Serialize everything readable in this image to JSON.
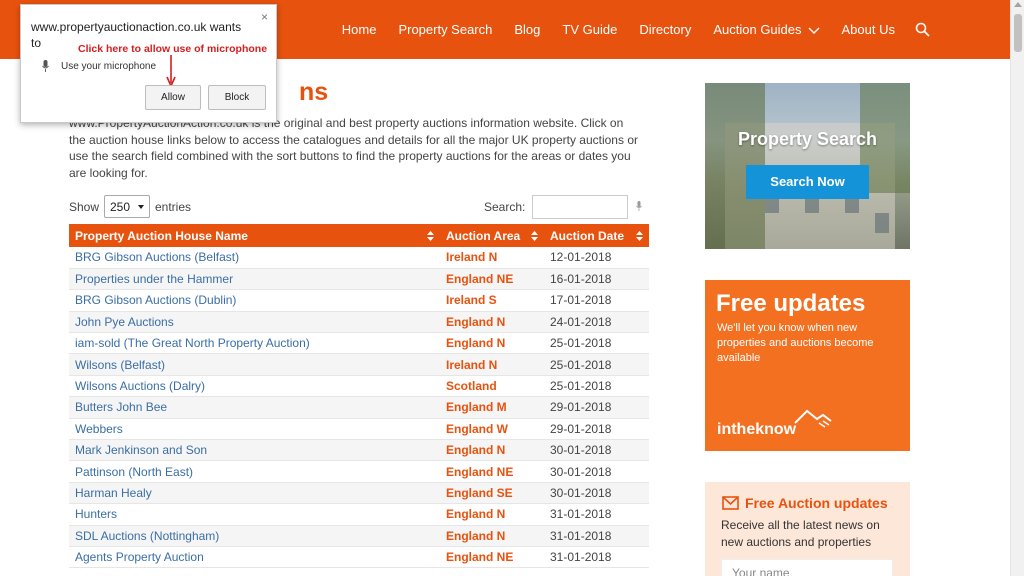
{
  "nav": {
    "items": [
      "Home",
      "Property Search",
      "Blog",
      "TV Guide",
      "Directory",
      "Auction Guides",
      "About Us"
    ],
    "icons": {
      "dropdown": "chevron-down-icon",
      "search": "search-icon"
    }
  },
  "page": {
    "title_visible": "ns",
    "intro": "www.PropertyAuctionAction.co.uk is the original and best property auctions information website. Click on the auction house links below to access the catalogues and details for all the major UK property auctions or use the search field combined with the sort buttons to find the property auctions for the areas or dates you are looking for."
  },
  "controls": {
    "show_label": "Show",
    "show_value": "250",
    "entries_label": "entries",
    "search_label": "Search:",
    "search_value": ""
  },
  "table": {
    "columns": [
      "Property Auction House Name",
      "Auction Area",
      "Auction Date"
    ],
    "rows": [
      [
        "BRG Gibson Auctions (Belfast)",
        "Ireland N",
        "12-01-2018"
      ],
      [
        "Properties under the Hammer",
        "England NE",
        "16-01-2018"
      ],
      [
        "BRG Gibson Auctions (Dublin)",
        "Ireland S",
        "17-01-2018"
      ],
      [
        "John Pye Auctions",
        "England N",
        "24-01-2018"
      ],
      [
        "iam-sold (The Great North Property Auction)",
        "England N",
        "25-01-2018"
      ],
      [
        "Wilsons (Belfast)",
        "Ireland N",
        "25-01-2018"
      ],
      [
        "Wilsons Auctions (Dalry)",
        "Scotland",
        "25-01-2018"
      ],
      [
        "Butters John Bee",
        "England M",
        "29-01-2018"
      ],
      [
        "Webbers",
        "England W",
        "29-01-2018"
      ],
      [
        "Mark Jenkinson and Son",
        "England N",
        "30-01-2018"
      ],
      [
        "Pattinson (North East)",
        "England NE",
        "30-01-2018"
      ],
      [
        "Harman Healy",
        "England SE",
        "30-01-2018"
      ],
      [
        "Hunters",
        "England N",
        "31-01-2018"
      ],
      [
        "SDL Auctions (Nottingham)",
        "England N",
        "31-01-2018"
      ],
      [
        "Agents Property Auction",
        "England NE",
        "31-01-2018"
      ]
    ]
  },
  "sidebar": {
    "property_search": {
      "title": "Property Search",
      "button": "Search Now"
    },
    "free_updates": {
      "title": "Free updates",
      "text": "We'll let you know when new properties and auctions become available",
      "brand": "intheknow"
    },
    "auction_updates": {
      "title": "Free Auction updates",
      "text": "Receive all the latest news on new auctions and properties",
      "name_placeholder": "Your name"
    }
  },
  "permission_popup": {
    "site": "www.propertyauctionaction.co.uk wants to",
    "permission": "Use your microphone",
    "annotation": "Click here to allow use of microphone",
    "allow": "Allow",
    "block": "Block",
    "close": "×"
  },
  "colors": {
    "brand_orange": "#e8520f",
    "link_blue": "#3a6ea5",
    "button_blue": "#1593d9",
    "annotation_red": "#d61e1e"
  }
}
